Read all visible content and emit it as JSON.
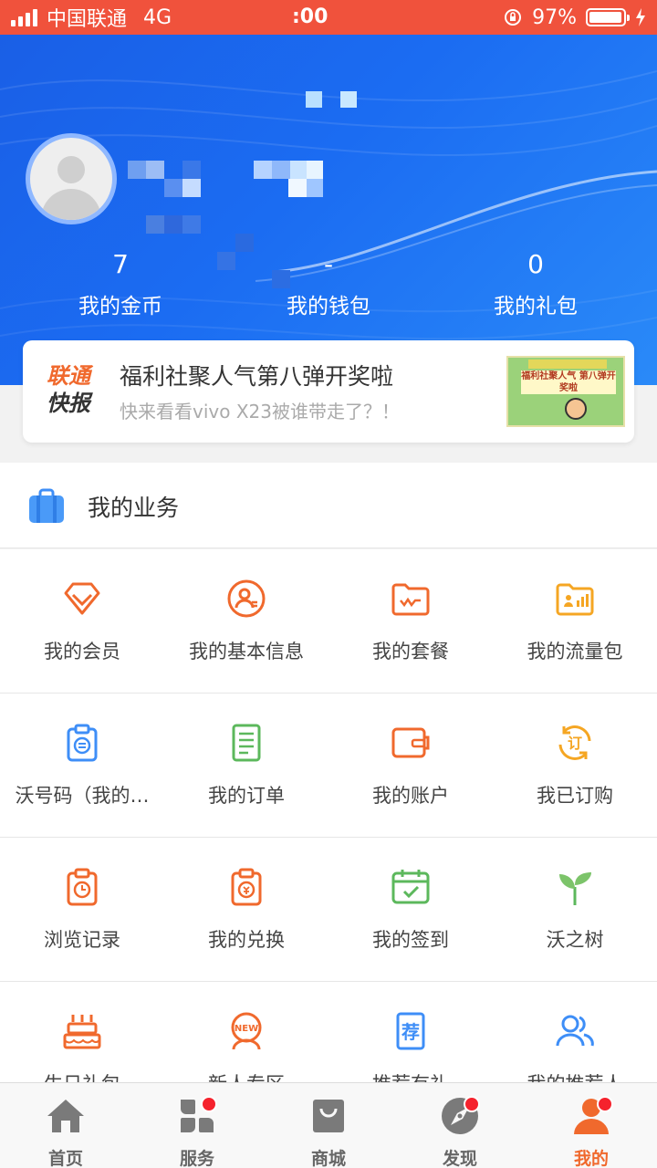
{
  "status_bar": {
    "carrier": "中国联通",
    "network": "4G",
    "time": ":00",
    "battery_percent": "97%",
    "battery_level": 0.97
  },
  "profile": {
    "stats": [
      {
        "value": "7",
        "label": "我的金币"
      },
      {
        "value": "-",
        "label": "我的钱包"
      },
      {
        "value": "0",
        "label": "我的礼包"
      }
    ]
  },
  "news": {
    "logo_line1": "联通",
    "logo_line2": "快报",
    "title": "福利社聚人气第八弹开奖啦",
    "subtitle": "快来看看vivo X23被谁带走了？！",
    "thumb_text": "福利社聚人气 第八弹开奖啦"
  },
  "section": {
    "title": "我的业务"
  },
  "grid": {
    "items": [
      {
        "label": "我的会员",
        "icon": "diamond-icon"
      },
      {
        "label": "我的基本信息",
        "icon": "user-info-icon"
      },
      {
        "label": "我的套餐",
        "icon": "package-folder-icon"
      },
      {
        "label": "我的流量包",
        "icon": "data-folder-icon"
      },
      {
        "label": "沃号码（我的…",
        "icon": "number-clipboard-icon"
      },
      {
        "label": "我的订单",
        "icon": "order-icon"
      },
      {
        "label": "我的账户",
        "icon": "wallet-icon"
      },
      {
        "label": "我已订购",
        "icon": "subscribed-icon"
      },
      {
        "label": "浏览记录",
        "icon": "history-icon"
      },
      {
        "label": "我的兑换",
        "icon": "exchange-icon"
      },
      {
        "label": "我的签到",
        "icon": "checkin-calendar-icon"
      },
      {
        "label": "沃之树",
        "icon": "sprout-icon"
      },
      {
        "label": "生日礼包",
        "icon": "birthday-cake-icon"
      },
      {
        "label": "新人专区",
        "icon": "new-user-icon"
      },
      {
        "label": "推荐有礼",
        "icon": "recommend-icon"
      },
      {
        "label": "我的推荐人",
        "icon": "referrer-icon"
      }
    ]
  },
  "tabbar": {
    "tabs": [
      {
        "label": "首页",
        "icon": "home-icon"
      },
      {
        "label": "服务",
        "icon": "services-icon"
      },
      {
        "label": "商城",
        "icon": "shopping-bag-icon"
      },
      {
        "label": "发现",
        "icon": "compass-icon"
      },
      {
        "label": "我的",
        "icon": "profile-icon"
      }
    ]
  },
  "colors": {
    "status_bar": "#f0523c",
    "header_blue": "#1b6cf2",
    "accent_orange": "#f0692d",
    "badge_red": "#f5222d"
  }
}
